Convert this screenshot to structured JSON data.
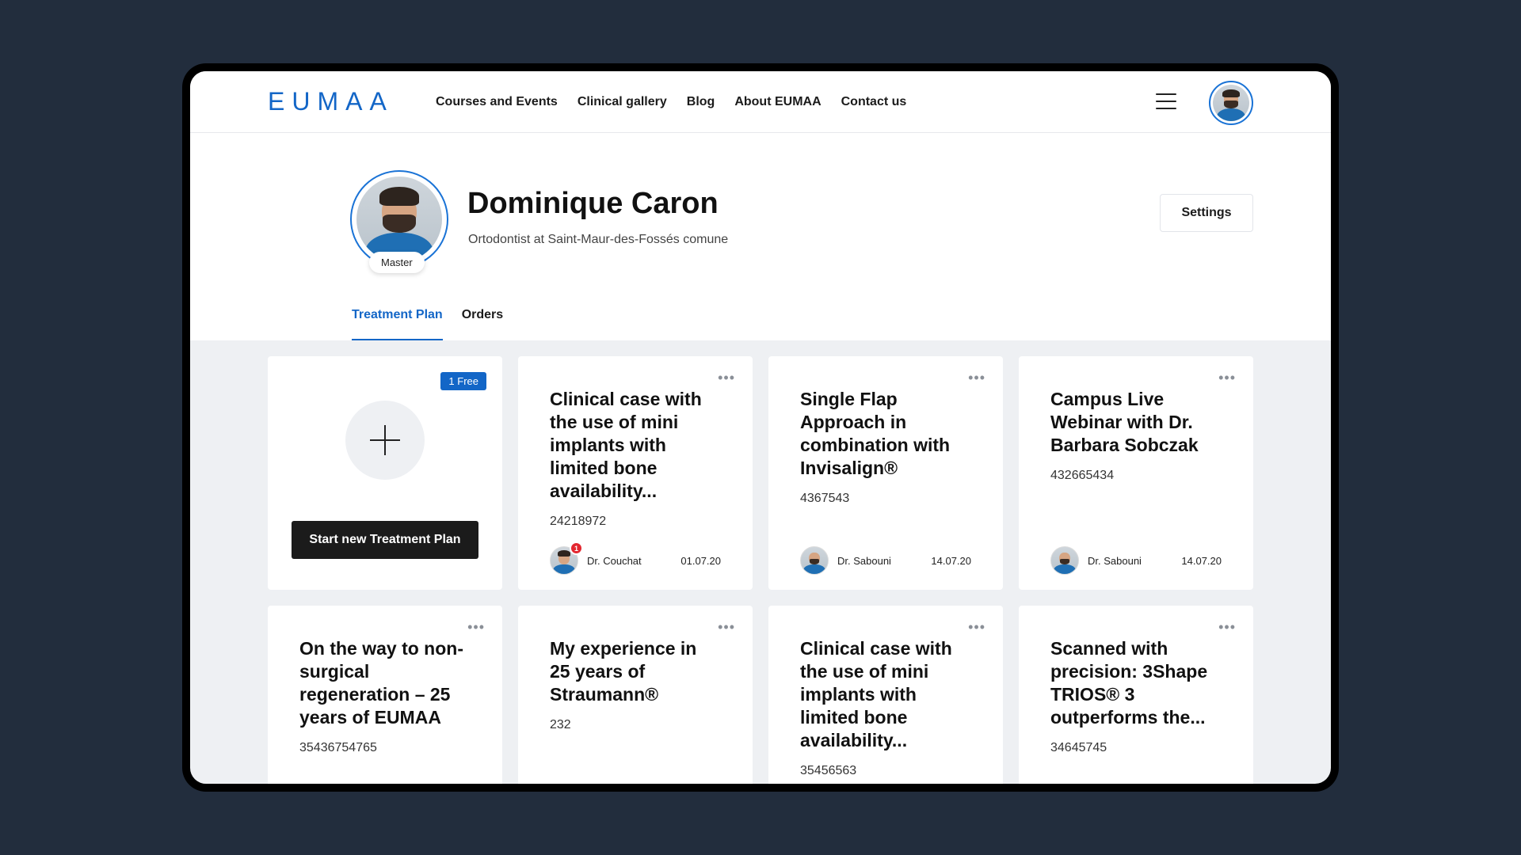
{
  "header": {
    "logo": "EUMAA",
    "nav": [
      "Courses and Events",
      "Clinical gallery",
      "Blog",
      "About EUMAA",
      "Contact us"
    ]
  },
  "profile": {
    "name": "Dominique Caron",
    "role": "Ortodontist at Saint-Maur-des-Fossés comune",
    "badge": "Master",
    "settings_label": "Settings"
  },
  "tabs": [
    {
      "label": "Treatment Plan",
      "active": true
    },
    {
      "label": "Orders",
      "active": false
    }
  ],
  "new_card": {
    "badge": "1 Free",
    "button": "Start new Treatment Plan"
  },
  "cards": [
    {
      "title": "Clinical case with the use of mini implants with limited bone availability...",
      "id": "24218972",
      "author": "Dr. Couchat",
      "date": "01.07.20",
      "notifications": "1"
    },
    {
      "title": "Single Flap Approach in combination with Invisalign®",
      "id": "4367543",
      "author": "Dr. Sabouni",
      "date": "14.07.20"
    },
    {
      "title": "Campus Live Webinar with Dr. Barbara Sobczak",
      "id": "432665434",
      "author": "Dr. Sabouni",
      "date": "14.07.20"
    },
    {
      "title": "On the way to non-surgical regeneration – 25 years of EUMAA",
      "id": "35436754765"
    },
    {
      "title": "My experience in 25 years of Straumann®",
      "id": "232"
    },
    {
      "title": "Clinical case with the use of mini implants with limited bone availability...",
      "id": "35456563"
    },
    {
      "title": "Scanned with precision: 3Shape TRIOS® 3 outperforms the...",
      "id": "34645745"
    }
  ],
  "colors": {
    "background": "#222d3d",
    "accent": "#1366c7",
    "notification": "#e3262f"
  },
  "icons": {
    "menu": "hamburger-icon",
    "card_menu": "more-horizontal-icon",
    "add": "plus-icon"
  }
}
